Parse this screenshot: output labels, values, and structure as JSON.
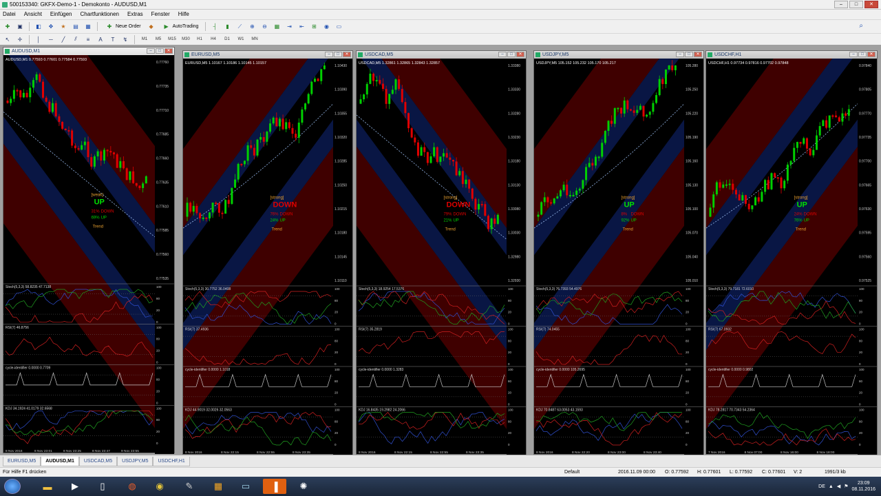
{
  "window": {
    "title": "500153340: GKFX-Demo-1 - Demokonto - AUDUSD,M1",
    "min": "–",
    "max": "□",
    "close": "✕"
  },
  "menu": [
    "Datei",
    "Ansicht",
    "Einfügen",
    "Chartfunktionen",
    "Extras",
    "Fenster",
    "Hilfe"
  ],
  "toolbar": {
    "new_order": "Neue Order",
    "autotrading": "AutoTrading"
  },
  "timeframes": [
    "M1",
    "M5",
    "M15",
    "M30",
    "H1",
    "H4",
    "D1",
    "W1",
    "MN"
  ],
  "charts": [
    {
      "title": "AUDUSD,M1",
      "header": "AUDUSD,M1  0.77593 0.77601 0.77584 0.77593",
      "prices": [
        "0.77760",
        "0.77735",
        "0.77710",
        "0.77685",
        "0.77660",
        "0.77635",
        "0.77610",
        "0.77585",
        "0.77560",
        "0.77535"
      ],
      "signal_box": [
        "[weak]",
        "UP",
        "31%",
        "69%",
        "DOWN",
        "UP",
        "Trend"
      ],
      "stoch": "Stoch(5,3,3) 58.8235 47.7138",
      "rsi": "RSI(7) 46.8756",
      "cycle": "cycle-identifier 0.0000 0.7709",
      "kdj": "KDJ 34.1924 41.0179 32.6568",
      "dates": [
        "8 Nov 2016",
        "8 Nov 23:01",
        "8 Nov 23:25",
        "8 Nov 23:47",
        "9 Nov 23:55"
      ],
      "ind_levels": [
        "100",
        "80",
        "20",
        "0"
      ],
      "color": "#e00000",
      "trend": "down",
      "label_colors": {
        "signal": "UP",
        "signal_color": "#00d000"
      }
    },
    {
      "title": "EURUSD,M5",
      "header": "EURUSD,M5  1.10167 1.10186 1.10145 1.10157",
      "prices": [
        "1.10430",
        "1.10390",
        "1.10355",
        "1.10320",
        "1.10285",
        "1.10250",
        "1.10215",
        "1.10180",
        "1.10145",
        "1.10110"
      ],
      "signal_box": [
        "[strong]",
        "DOWN",
        "76%",
        "24%",
        "DOWN",
        "UP",
        "Trend"
      ],
      "stoch": "Stoch(5,3,3) 30.7752 36.0408",
      "rsi": "RSI(7) 37.4936",
      "cycle": "cycle-identifier 0.0000 1.1018",
      "kdj": "KDJ 44.9019 32.0026 32.0563",
      "dates": [
        "8 Nov 2016",
        "8 Nov 22:15",
        "8 Nov 22:55",
        "8 Nov 23:35"
      ],
      "ind_levels": [
        "100",
        "80",
        "20",
        "0"
      ],
      "color": "#e00000",
      "trend": "up"
    },
    {
      "title": "USDCAD,M5",
      "header": "USDCAD,M5  1.32861 1.32865 1.32843 1.32857",
      "prices": [
        "1.33380",
        "1.33330",
        "1.33280",
        "1.33230",
        "1.33180",
        "1.33130",
        "1.33080",
        "1.33030",
        "1.32980",
        "1.32930"
      ],
      "signal_box": [
        "[strong]",
        "DOWN",
        "79%",
        "21%",
        "DOWN",
        "UP",
        "Trend"
      ],
      "stoch": "Stoch(5,3,3) 18.9254 17.5376",
      "rsi": "RSI(7) 35.2819",
      "cycle": "cycle-identifier 0.0000 1.3283",
      "kdj": "KDJ 16.8435 19.2982 24.2066",
      "dates": [
        "8 Nov 2016",
        "8 Nov 22:15",
        "8 Nov 22:55",
        "8 Nov 23:35"
      ],
      "ind_levels": [
        "100",
        "80",
        "20",
        "0"
      ],
      "color": "#e00000",
      "trend": "down"
    },
    {
      "title": "USDJPY,M5",
      "header": "USDJPY,M5  105.152 105.232 105.170 105.217",
      "prices": [
        "105.280",
        "105.250",
        "105.220",
        "105.190",
        "105.160",
        "105.130",
        "105.100",
        "105.070",
        "105.040",
        "105.010"
      ],
      "signal_box": [
        "[strong]",
        "UP",
        "8%",
        "92%",
        "DOWN",
        "UP",
        "Trend"
      ],
      "stoch": "Stoch(5,3,3) 76.7393 54.4976",
      "rsi": "RSI(7) 74.0455",
      "cycle": "cycle-identifier 0.0000 105.2695",
      "kdj": "KDJ 70.8487 63.0053 43.1593",
      "dates": [
        "8 Nov 2016",
        "8 Nov 22:20",
        "8 Nov 23:00",
        "8 Nov 23:40"
      ],
      "ind_levels": [
        "100",
        "80",
        "20",
        "0"
      ],
      "color": "#e00000",
      "trend": "up"
    },
    {
      "title": "USDCHF,H1",
      "header": "USDCHF,H1  0.97734 0.97816 0.97702 0.97848",
      "prices": [
        "0.97840",
        "0.97805",
        "0.97770",
        "0.97735",
        "0.97700",
        "0.97665",
        "0.97630",
        "0.97595",
        "0.97560",
        "0.97525"
      ],
      "signal_box": [
        "[strong]",
        "UP",
        "24%",
        "76%",
        "DOWN",
        "UP",
        "Trend"
      ],
      "stoch": "Stoch(5,3,3) 79.7181 72.6010",
      "rsi": "RSI(7) 67.0932",
      "cycle": "cycle-identifier 0.0000 0.9802",
      "kdj": "KDJ 78.2817 70.7343 54.2364",
      "dates": [
        "7 Nov 2016",
        "8 Nov 07:00",
        "8 Nov 16:00",
        "8 Nov 18:00"
      ],
      "ind_levels": [
        "100",
        "80",
        "20",
        "0"
      ],
      "color": "#e00000",
      "trend": "up"
    }
  ],
  "tabs": [
    "EURUSD,M5",
    "AUDUSD,M1",
    "USDCAD,M5",
    "USDJPY,M5",
    "USDCHF,H1"
  ],
  "status": {
    "help": "Für Hilfe F1 drücken",
    "profile": "Default",
    "datetime": "2016.11.09 00:00",
    "open": "O: 0.77592",
    "high": "H: 0.77601",
    "low": "L: 0.77592",
    "close": "C: 0.77601",
    "volume": "V: 2",
    "traffic": "1991/3 kb"
  },
  "taskbar": {
    "time": "23:09",
    "date": "08.11.2016",
    "lang": "DE"
  }
}
